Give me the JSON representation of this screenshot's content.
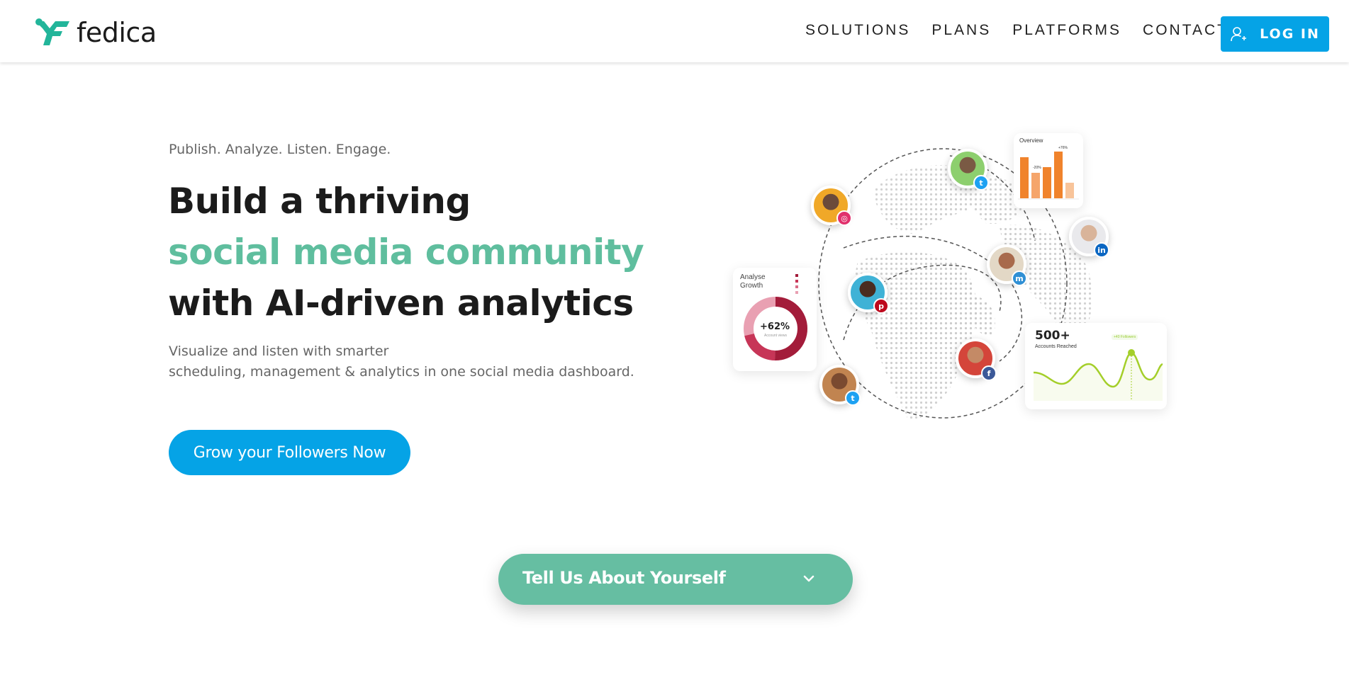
{
  "brand": {
    "name": "fedica",
    "color": "#22b59a"
  },
  "nav": {
    "items": [
      "SOLUTIONS",
      "PLANS",
      "PLATFORMS",
      "CONTACT"
    ],
    "login_label": "LOG IN"
  },
  "hero": {
    "tagline": "Publish. Analyze. Listen. Engage.",
    "headline_line1": "Build a thriving",
    "headline_line2": "social media community",
    "headline_line3": "with AI-driven analytics",
    "sub_line1": "Visualize and listen with smarter",
    "sub_line2": "scheduling, management & analytics in one social media dashboard.",
    "cta_label": "Grow your Followers Now"
  },
  "dropdown": {
    "label": "Tell Us About Yourself"
  },
  "illustration": {
    "overview_card": {
      "title": "Overview",
      "bar_annotation_1": "-20%",
      "bar_annotation_2": "+76%"
    },
    "growth_card": {
      "title_line1": "Analyse",
      "title_line2": "Growth",
      "value": "+62%",
      "caption": "Account views"
    },
    "reach_card": {
      "value": "500+",
      "label": "Accounts Reached",
      "tag": "+40 Followers"
    }
  },
  "colors": {
    "accent_blue": "#05a3e6",
    "accent_green": "#5fbe9e",
    "dropdown_green": "#66bea2",
    "text_dark": "#1b1b1b",
    "text_muted": "#666666"
  }
}
